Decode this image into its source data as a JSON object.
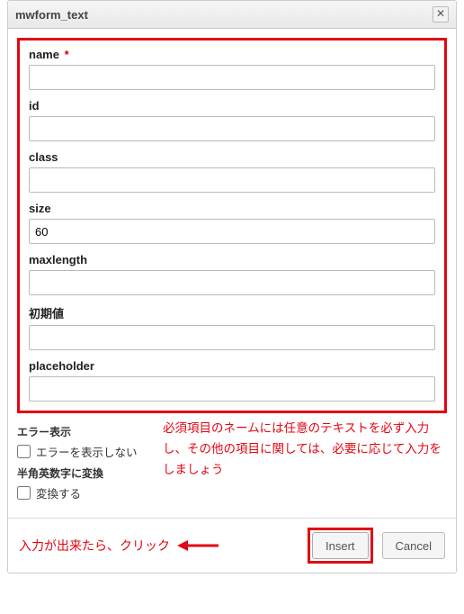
{
  "dialog": {
    "title": "mwform_text",
    "close_glyph": "✕"
  },
  "fields": {
    "name": {
      "label": "name",
      "required_mark": "*",
      "value": ""
    },
    "id": {
      "label": "id",
      "value": ""
    },
    "class": {
      "label": "class",
      "value": ""
    },
    "size": {
      "label": "size",
      "value": "60"
    },
    "maxlength": {
      "label": "maxlength",
      "value": ""
    },
    "initial": {
      "label": "初期値",
      "value": ""
    },
    "placeholder": {
      "label": "placeholder",
      "value": ""
    }
  },
  "error_display": {
    "group_label": "エラー表示",
    "checkbox_label": "エラーを表示しない"
  },
  "convert_alnum": {
    "group_label": "半角英数字に変換",
    "checkbox_label": "変換する"
  },
  "notes": {
    "side_text": "必須項目のネームには任意のテキストを必ず入力し、その他の項目に関しては、必要に応じて入力をしましょう",
    "footer_text": "入力が出来たら、クリック"
  },
  "footer": {
    "insert_label": "Insert",
    "cancel_label": "Cancel"
  }
}
